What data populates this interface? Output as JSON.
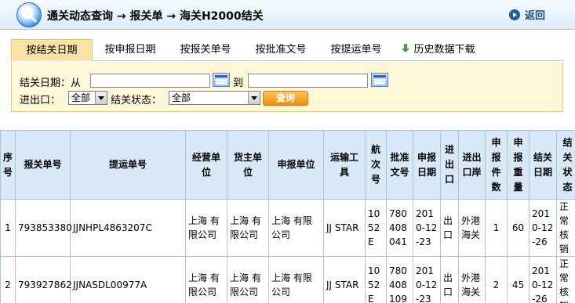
{
  "header": {
    "title": "通关动态查询 → 报关单 → 海关H2000结关",
    "back_label": "返回"
  },
  "tabs": [
    {
      "label": "按结关日期",
      "active": true
    },
    {
      "label": "按申报日期",
      "active": false
    },
    {
      "label": "按报关单号",
      "active": false
    },
    {
      "label": "按批准文号",
      "active": false
    },
    {
      "label": "按提运单号",
      "active": false
    },
    {
      "label": "历史数据下载",
      "active": false
    }
  ],
  "filters": {
    "date_label": "结关日期：从",
    "date_from": "",
    "date_to_label": "到",
    "date_to": "",
    "io_label": "进出口：",
    "io_value": "全部",
    "status_label": "结关状态：",
    "status_value": "全部",
    "query_label": "查询"
  },
  "table": {
    "headers": [
      "序号",
      "报关单号",
      "提运单号",
      "经营单位",
      "货主单位",
      "申报单位",
      "运输工具",
      "航次号",
      "批准文号",
      "申报日期",
      "进出口",
      "进出口岸",
      "申报件数",
      "申报重量",
      "结关日期",
      "结关状态"
    ],
    "rows": [
      {
        "seq": "1",
        "declaration_no": "793853380",
        "bill_no": "JJNHPL4863207C",
        "operator": "上海\n有限公司",
        "owner": "上海\n有限公司",
        "declarant": "上海\n有限公司",
        "transport": "JJ STAR",
        "voyage": "1052E",
        "approval_no": "780408041",
        "declare_date": "2010-12-23",
        "io": "出口",
        "port": "外港海关",
        "pieces": "1",
        "weight": "60",
        "close_date": "2010-12-26",
        "status": "正常核销"
      },
      {
        "seq": "2",
        "declaration_no": "793927862",
        "bill_no": "JJNASDL00977A",
        "operator": "上海\n有限公司",
        "owner": "上海\n有限公司",
        "declarant": "上海\n有限公司",
        "transport": "JJ STAR",
        "voyage": "1052E",
        "approval_no": "780408109",
        "declare_date": "2010-12-23",
        "io": "出口",
        "port": "外港海关",
        "pieces": "2",
        "weight": "45",
        "close_date": "2010-12-26",
        "status": "正常核销"
      }
    ]
  }
}
